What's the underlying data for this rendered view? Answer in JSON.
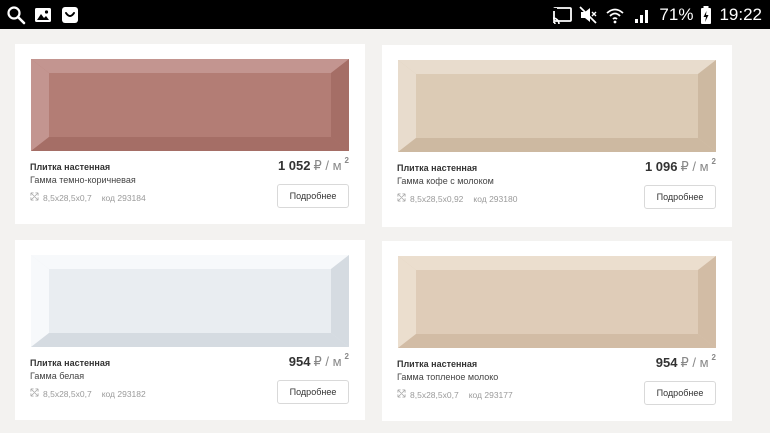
{
  "statusbar": {
    "battery_percent": "71%",
    "time": "19:22"
  },
  "products": [
    {
      "name": "Плитка настенная",
      "collection": "Гамма темно-коричневая",
      "size": "8,5x28,5x0,7",
      "code": "код 293184",
      "price": "1 052",
      "currency": "₽ / м",
      "unit_sup": "2",
      "button": "Подробнее",
      "tile_color": "#b37d75",
      "tile_edge": "#a56e66",
      "tile_light": "#c39590"
    },
    {
      "name": "Плитка настенная",
      "collection": "Гамма кофе с молоком",
      "size": "8,5x28,5x0,92",
      "code": "код 293180",
      "price": "1 096",
      "currency": "₽ / м",
      "unit_sup": "2",
      "button": "Подробнее",
      "tile_color": "#dccbb5",
      "tile_edge": "#cdb9a1",
      "tile_light": "#e8dccd"
    },
    {
      "name": "Плитка настенная",
      "collection": "Гамма белая",
      "size": "8,5x28,5x0,7",
      "code": "код 293182",
      "price": "954",
      "currency": "₽ / м",
      "unit_sup": "2",
      "button": "Подробнее",
      "tile_color": "#e9edf1",
      "tile_edge": "#d5dbe1",
      "tile_light": "#f7f9fb"
    },
    {
      "name": "Плитка настенная",
      "collection": "Гамма топленое молоко",
      "size": "8,5x28,5x0,7",
      "code": "код 293177",
      "price": "954",
      "currency": "₽ / м",
      "unit_sup": "2",
      "button": "Подробнее",
      "tile_color": "#dfccb8",
      "tile_edge": "#d2bca5",
      "tile_light": "#ebdece"
    }
  ]
}
